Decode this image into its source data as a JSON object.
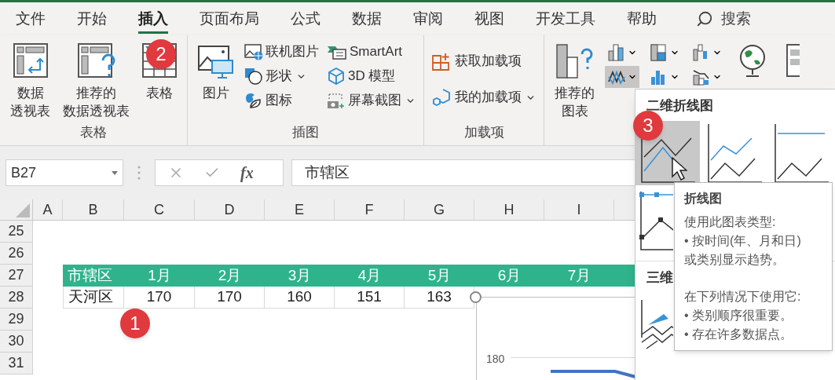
{
  "tabs": [
    {
      "label": "文件",
      "selected": false
    },
    {
      "label": "开始",
      "selected": false
    },
    {
      "label": "插入",
      "selected": true
    },
    {
      "label": "页面布局",
      "selected": false
    },
    {
      "label": "公式",
      "selected": false
    },
    {
      "label": "数据",
      "selected": false
    },
    {
      "label": "审阅",
      "selected": false
    },
    {
      "label": "视图",
      "selected": false
    },
    {
      "label": "开发工具",
      "selected": false
    },
    {
      "label": "帮助",
      "selected": false
    }
  ],
  "search": {
    "placeholder": "搜索"
  },
  "ribbon": {
    "groups": [
      {
        "label": "表格",
        "items": [
          {
            "kind": "large",
            "lines": [
              "数据",
              "透视表"
            ]
          },
          {
            "kind": "large",
            "lines": [
              "推荐的",
              "数据透视表"
            ]
          },
          {
            "kind": "large",
            "lines": [
              "表格"
            ]
          }
        ]
      },
      {
        "label": "插图",
        "items": [
          {
            "kind": "large",
            "lines": [
              "图片"
            ]
          },
          {
            "kind": "small",
            "label": "联机图片",
            "has_menu": false
          },
          {
            "kind": "small",
            "label": "形状",
            "has_menu": true
          },
          {
            "kind": "small",
            "label": "图标",
            "has_menu": false
          },
          {
            "kind": "small",
            "label": "SmartArt",
            "has_menu": false
          },
          {
            "kind": "small",
            "label": "3D 模型",
            "has_menu": false
          },
          {
            "kind": "small",
            "label": "屏幕截图",
            "has_menu": true
          }
        ]
      },
      {
        "label": "加载项",
        "items": [
          {
            "kind": "small",
            "label": "获取加载项",
            "has_menu": false
          },
          {
            "kind": "small",
            "label": "我的加载项",
            "has_menu": true
          }
        ]
      },
      {
        "items": [
          {
            "kind": "large",
            "lines": [
              "推荐的",
              "图表"
            ]
          },
          {
            "kind": "chart_button",
            "selected": false
          },
          {
            "kind": "chart_button",
            "selected": true
          },
          {
            "kind": "chart_button",
            "selected": false
          },
          {
            "kind": "chart_button",
            "selected": false
          },
          {
            "kind": "chart_button",
            "selected": false
          },
          {
            "kind": "chart_button",
            "selected": false
          },
          {
            "kind": "icon_only"
          },
          {
            "kind": "icon_only"
          }
        ]
      }
    ]
  },
  "formula_bar": {
    "name_box": "B27",
    "fx": "fx",
    "formula": "市辖区"
  },
  "sheet": {
    "columns": [
      "A",
      "B",
      "C",
      "D",
      "E",
      "F",
      "G",
      "H",
      "I"
    ],
    "rows": [
      {
        "number": "25",
        "kind": "empty"
      },
      {
        "number": "26",
        "kind": "empty"
      },
      {
        "number": "27",
        "kind": "header",
        "cells": [
          "市辖区",
          "1月",
          "2月",
          "3月",
          "4月",
          "5月",
          "6月",
          "7月"
        ]
      },
      {
        "number": "28",
        "kind": "data",
        "cells": [
          "天河区",
          "170",
          "170",
          "160",
          "151",
          "163"
        ]
      },
      {
        "number": "29",
        "kind": "empty"
      },
      {
        "number": "30",
        "kind": "empty"
      },
      {
        "number": "31",
        "kind": "empty"
      }
    ]
  },
  "chart": {
    "ytick": "180"
  },
  "gallery": {
    "sections": [
      {
        "title": "二维折线图",
        "options": [
          {
            "selected": true
          },
          {
            "selected": false
          },
          {
            "selected": false
          },
          {
            "selected": false
          }
        ]
      },
      {
        "title": "三维",
        "options": [
          {
            "selected": false
          }
        ]
      }
    ]
  },
  "tooltip": {
    "title": "折线图",
    "paragraphs": [
      [
        "使用此图表类型:",
        "• 按时间(年、月和日)",
        "或类别显示趋势。"
      ],
      [
        "在下列情况下使用它:",
        "• 类别顺序很重要。",
        "• 存在许多数据点。"
      ]
    ]
  },
  "badges": [
    {
      "text": "1"
    },
    {
      "text": "2"
    },
    {
      "text": "3"
    }
  ]
}
